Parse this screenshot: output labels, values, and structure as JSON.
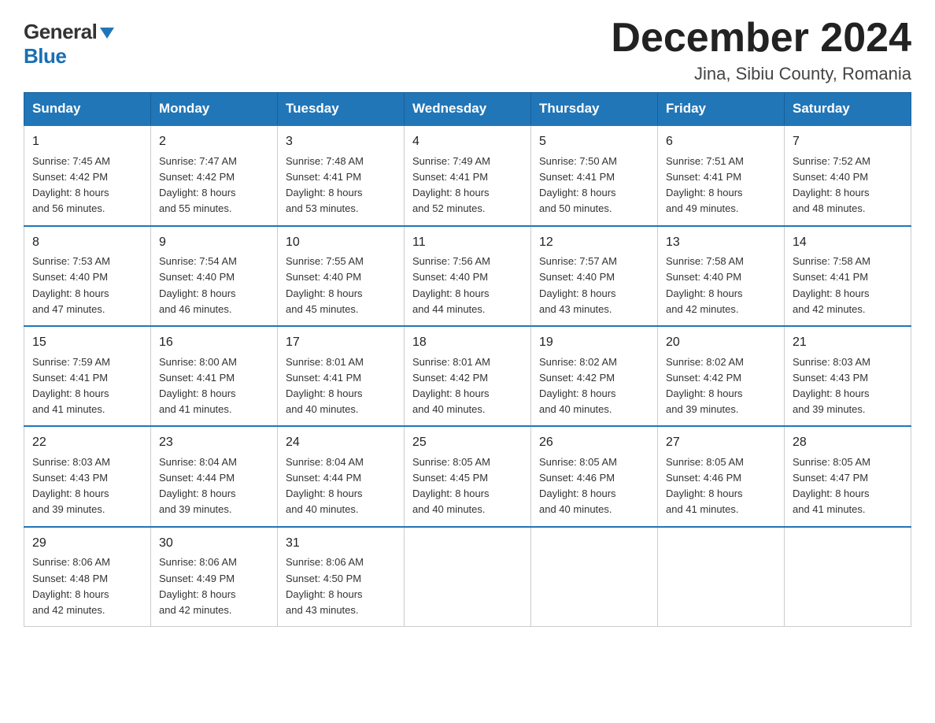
{
  "header": {
    "logo": {
      "general": "General",
      "blue": "Blue",
      "arrow": "▶"
    },
    "title": "December 2024",
    "subtitle": "Jina, Sibiu County, Romania"
  },
  "weekdays": [
    "Sunday",
    "Monday",
    "Tuesday",
    "Wednesday",
    "Thursday",
    "Friday",
    "Saturday"
  ],
  "weeks": [
    [
      {
        "day": "1",
        "info": "Sunrise: 7:45 AM\nSunset: 4:42 PM\nDaylight: 8 hours\nand 56 minutes."
      },
      {
        "day": "2",
        "info": "Sunrise: 7:47 AM\nSunset: 4:42 PM\nDaylight: 8 hours\nand 55 minutes."
      },
      {
        "day": "3",
        "info": "Sunrise: 7:48 AM\nSunset: 4:41 PM\nDaylight: 8 hours\nand 53 minutes."
      },
      {
        "day": "4",
        "info": "Sunrise: 7:49 AM\nSunset: 4:41 PM\nDaylight: 8 hours\nand 52 minutes."
      },
      {
        "day": "5",
        "info": "Sunrise: 7:50 AM\nSunset: 4:41 PM\nDaylight: 8 hours\nand 50 minutes."
      },
      {
        "day": "6",
        "info": "Sunrise: 7:51 AM\nSunset: 4:41 PM\nDaylight: 8 hours\nand 49 minutes."
      },
      {
        "day": "7",
        "info": "Sunrise: 7:52 AM\nSunset: 4:40 PM\nDaylight: 8 hours\nand 48 minutes."
      }
    ],
    [
      {
        "day": "8",
        "info": "Sunrise: 7:53 AM\nSunset: 4:40 PM\nDaylight: 8 hours\nand 47 minutes."
      },
      {
        "day": "9",
        "info": "Sunrise: 7:54 AM\nSunset: 4:40 PM\nDaylight: 8 hours\nand 46 minutes."
      },
      {
        "day": "10",
        "info": "Sunrise: 7:55 AM\nSunset: 4:40 PM\nDaylight: 8 hours\nand 45 minutes."
      },
      {
        "day": "11",
        "info": "Sunrise: 7:56 AM\nSunset: 4:40 PM\nDaylight: 8 hours\nand 44 minutes."
      },
      {
        "day": "12",
        "info": "Sunrise: 7:57 AM\nSunset: 4:40 PM\nDaylight: 8 hours\nand 43 minutes."
      },
      {
        "day": "13",
        "info": "Sunrise: 7:58 AM\nSunset: 4:40 PM\nDaylight: 8 hours\nand 42 minutes."
      },
      {
        "day": "14",
        "info": "Sunrise: 7:58 AM\nSunset: 4:41 PM\nDaylight: 8 hours\nand 42 minutes."
      }
    ],
    [
      {
        "day": "15",
        "info": "Sunrise: 7:59 AM\nSunset: 4:41 PM\nDaylight: 8 hours\nand 41 minutes."
      },
      {
        "day": "16",
        "info": "Sunrise: 8:00 AM\nSunset: 4:41 PM\nDaylight: 8 hours\nand 41 minutes."
      },
      {
        "day": "17",
        "info": "Sunrise: 8:01 AM\nSunset: 4:41 PM\nDaylight: 8 hours\nand 40 minutes."
      },
      {
        "day": "18",
        "info": "Sunrise: 8:01 AM\nSunset: 4:42 PM\nDaylight: 8 hours\nand 40 minutes."
      },
      {
        "day": "19",
        "info": "Sunrise: 8:02 AM\nSunset: 4:42 PM\nDaylight: 8 hours\nand 40 minutes."
      },
      {
        "day": "20",
        "info": "Sunrise: 8:02 AM\nSunset: 4:42 PM\nDaylight: 8 hours\nand 39 minutes."
      },
      {
        "day": "21",
        "info": "Sunrise: 8:03 AM\nSunset: 4:43 PM\nDaylight: 8 hours\nand 39 minutes."
      }
    ],
    [
      {
        "day": "22",
        "info": "Sunrise: 8:03 AM\nSunset: 4:43 PM\nDaylight: 8 hours\nand 39 minutes."
      },
      {
        "day": "23",
        "info": "Sunrise: 8:04 AM\nSunset: 4:44 PM\nDaylight: 8 hours\nand 39 minutes."
      },
      {
        "day": "24",
        "info": "Sunrise: 8:04 AM\nSunset: 4:44 PM\nDaylight: 8 hours\nand 40 minutes."
      },
      {
        "day": "25",
        "info": "Sunrise: 8:05 AM\nSunset: 4:45 PM\nDaylight: 8 hours\nand 40 minutes."
      },
      {
        "day": "26",
        "info": "Sunrise: 8:05 AM\nSunset: 4:46 PM\nDaylight: 8 hours\nand 40 minutes."
      },
      {
        "day": "27",
        "info": "Sunrise: 8:05 AM\nSunset: 4:46 PM\nDaylight: 8 hours\nand 41 minutes."
      },
      {
        "day": "28",
        "info": "Sunrise: 8:05 AM\nSunset: 4:47 PM\nDaylight: 8 hours\nand 41 minutes."
      }
    ],
    [
      {
        "day": "29",
        "info": "Sunrise: 8:06 AM\nSunset: 4:48 PM\nDaylight: 8 hours\nand 42 minutes."
      },
      {
        "day": "30",
        "info": "Sunrise: 8:06 AM\nSunset: 4:49 PM\nDaylight: 8 hours\nand 42 minutes."
      },
      {
        "day": "31",
        "info": "Sunrise: 8:06 AM\nSunset: 4:50 PM\nDaylight: 8 hours\nand 43 minutes."
      },
      null,
      null,
      null,
      null
    ]
  ]
}
